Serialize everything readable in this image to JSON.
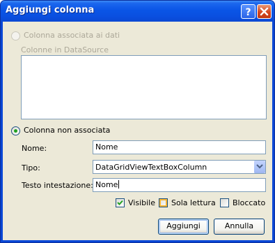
{
  "window": {
    "title": "Aggiungi colonna"
  },
  "data_bound": {
    "radio_label": "Colonna associata ai dati",
    "columns_label": "Colonne in DataSource",
    "columns": []
  },
  "unbound": {
    "radio_label": "Colonna non associata",
    "name_label": "Nome:",
    "name_value": "Nome",
    "type_label": "Tipo:",
    "type_value": "DataGridViewTextBoxColumn",
    "header_label": "Testo intestazione:",
    "header_value": "Nome"
  },
  "options": {
    "visible_label": "Visibile",
    "visible_checked": true,
    "readonly_label": "Sola lettura",
    "readonly_checked": false,
    "frozen_label": "Bloccato",
    "frozen_checked": false
  },
  "buttons": {
    "add": "Aggiungi",
    "cancel": "Annulla"
  },
  "icons": {
    "help": "help-icon",
    "close": "close-icon",
    "dropdown": "chevron-down-icon"
  },
  "colors": {
    "titlebar": "#0a55e6",
    "client": "#ece9d8",
    "border": "#7f9db9"
  }
}
